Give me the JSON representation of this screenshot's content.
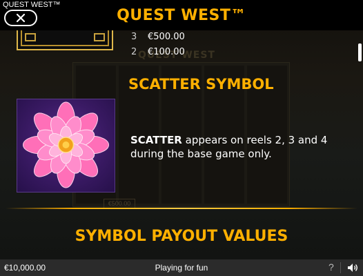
{
  "header": {
    "brand": "QUEST WEST™",
    "title": "QUEST WEST™",
    "close_icon": "close-x-icon"
  },
  "paytable": {
    "previous_symbol_rows": [
      {
        "count": "3",
        "value": "€500.00"
      },
      {
        "count": "2",
        "value": "€100.00"
      }
    ],
    "scatter": {
      "title": "SCATTER SYMBOL",
      "symbol_icon": "lotus-flower-icon",
      "description_bold": "SCATTER",
      "description_rest": " appears on reels 2, 3 and 4 during the base game only."
    },
    "next_section_title": "SYMBOL PAYOUT VALUES"
  },
  "background": {
    "ghost_title": "QUEST WEST",
    "ghost_chip": "€500.00"
  },
  "footer": {
    "balance": "€10,000.00",
    "mode": "Playing for fun",
    "help_label": "?",
    "sound_icon": "speaker-icon"
  },
  "colors": {
    "accent": "#ffb000",
    "footer_bg": "#2b2b2b",
    "scatter_bg": "#3a1a64"
  }
}
